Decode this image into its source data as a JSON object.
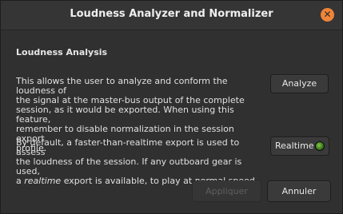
{
  "window": {
    "title": "Loudness Analyzer and Normalizer",
    "close_glyph": "✕"
  },
  "section": {
    "title": "Loudness Analysis"
  },
  "description": {
    "line1": "This allows the user to analyze and conform the loudness of",
    "line2": "the signal at the master-bus output of the complete",
    "line3": "session, as it would be exported. When using this feature,",
    "line4": "remember to disable normalization in the session export",
    "line5": "profile."
  },
  "realtime_note": {
    "line1": "By default, a faster-than-realtime export is used to assess",
    "line2": "the loudness of the session. If any outboard gear is used,",
    "line3_pre": "a ",
    "line3_em": "realtime",
    "line3_post": " export is available, to play at normal speed."
  },
  "buttons": {
    "analyze": "Analyze",
    "realtime": "Realtime",
    "apply": "Appliquer",
    "cancel": "Annuler"
  },
  "colors": {
    "accent": "#f08437",
    "led_active": "#86c94a"
  }
}
